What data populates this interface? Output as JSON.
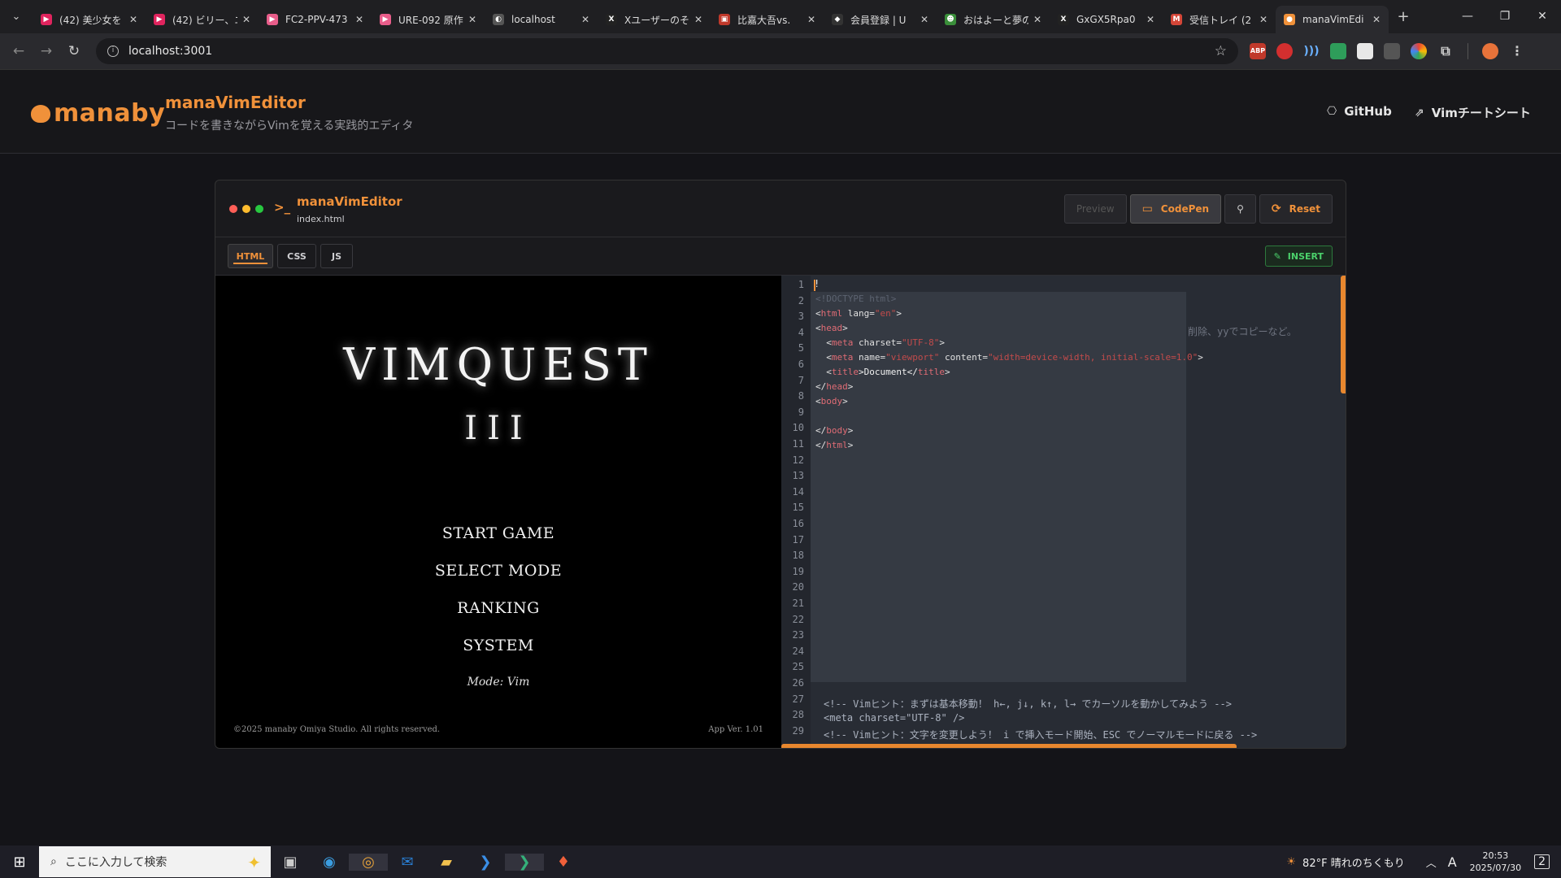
{
  "browser": {
    "tabs": [
      {
        "title": "(42) 美少女を",
        "favicon_color": "#e0245e",
        "favicon": "▶"
      },
      {
        "title": "(42) ビリー、エ",
        "favicon_color": "#e0245e",
        "favicon": "▶"
      },
      {
        "title": "FC2-PPV-473",
        "favicon_color": "#e85d8a",
        "favicon": "▶"
      },
      {
        "title": "URE-092 原作",
        "favicon_color": "#e85d8a",
        "favicon": "▶"
      },
      {
        "title": "localhost",
        "favicon_color": "#555555",
        "favicon": "◐"
      },
      {
        "title": "Xユーザーのそ",
        "favicon_color": "#222222",
        "favicon": "X"
      },
      {
        "title": "比嘉大吾vs.",
        "favicon_color": "#c0392b",
        "favicon": "▣"
      },
      {
        "title": "会員登録 | U",
        "favicon_color": "#333333",
        "favicon": "◆"
      },
      {
        "title": "おはよーと夢の",
        "favicon_color": "#3a8f3a",
        "favicon": "☻"
      },
      {
        "title": "GxGX5Rpa0",
        "favicon_color": "#222222",
        "favicon": "X"
      },
      {
        "title": "受信トレイ (2",
        "favicon_color": "#d44638",
        "favicon": "M"
      },
      {
        "title": "manaVimEdi",
        "favicon_color": "#f0913a",
        "favicon": "●"
      }
    ],
    "url": "localhost:3001"
  },
  "header": {
    "logo": "manaby",
    "title": "manaVimEditor",
    "subtitle": "コードを書きながらVimを覚える実践的エディタ",
    "github": "GitHub",
    "cheatsheet": "Vimチートシート"
  },
  "editor": {
    "title": "manaVimEditor",
    "filename": "index.html",
    "buttons": {
      "preview": "Preview",
      "codepen": "CodePen",
      "reset": "Reset"
    },
    "tabs": [
      "HTML",
      "CSS",
      "JS"
    ],
    "mode": "INSERT"
  },
  "preview": {
    "title": "VIMQUEST",
    "number": "III",
    "menu": [
      "START GAME",
      "SELECT MODE",
      "RANKING",
      "SYSTEM"
    ],
    "mode": "Mode: Vim",
    "copyright": "©2025 manaby Omiya Studio. All rights reserved.",
    "version": "App Ver. 1.01"
  },
  "code": {
    "first_line": "!",
    "line_numbers": [
      "1",
      "2",
      "3",
      "4",
      "5",
      "6",
      "7",
      "8",
      "9",
      "10",
      "11",
      "12",
      "13",
      "14",
      "15",
      "16",
      "17",
      "18",
      "19",
      "20",
      "21",
      "22",
      "23",
      "24",
      "25",
      "26",
      "27",
      "28",
      "29"
    ],
    "popup_lines": {
      "l2": "<!DOCTYPE html>",
      "l3a": "<",
      "l3b": "html",
      "l3c": " lang=",
      "l3d": "\"en\"",
      "l3e": ">",
      "l4a": "<",
      "l4b": "head",
      "l4c": ">",
      "l5a": "  <",
      "l5b": "meta",
      "l5c": " charset=",
      "l5d": "\"UTF-8\"",
      "l5e": ">",
      "l6a": "  <",
      "l6b": "meta",
      "l6c": " name=",
      "l6d": "\"viewport\"",
      "l6e": " content=",
      "l6f": "\"width=device-width, initial-scale=1.0\"",
      "l6g": ">",
      "l7a": "  <",
      "l7b": "title",
      "l7c": ">Document</",
      "l7d": "title",
      "l7e": ">",
      "l8a": "</",
      "l8b": "head",
      "l8c": ">",
      "l9a": "<",
      "l9b": "body",
      "l9c": ">",
      "l11a": "</",
      "l11b": "body",
      "l11c": ">",
      "l12a": "</",
      "l12b": "html",
      "l12c": ">"
    },
    "background_hint": "削除、yyでコピーなど。",
    "line27": "<!-- Vimヒント：まずは基本移動！ h←, j↓, k↑, l→ でカーソルを動かしてみよう -->",
    "line28": "<meta charset=\"UTF-8\" />",
    "line29": "<!-- Vimヒント：文字を変更しよう！ i で挿入モード開始、ESC でノーマルモードに戻る -->"
  },
  "taskbar": {
    "search_placeholder": "ここに入力して検索",
    "weather": "82°F  晴れのちくもり",
    "time": "20:53",
    "date": "2025/07/30",
    "ime": "A",
    "notifications": "2"
  }
}
